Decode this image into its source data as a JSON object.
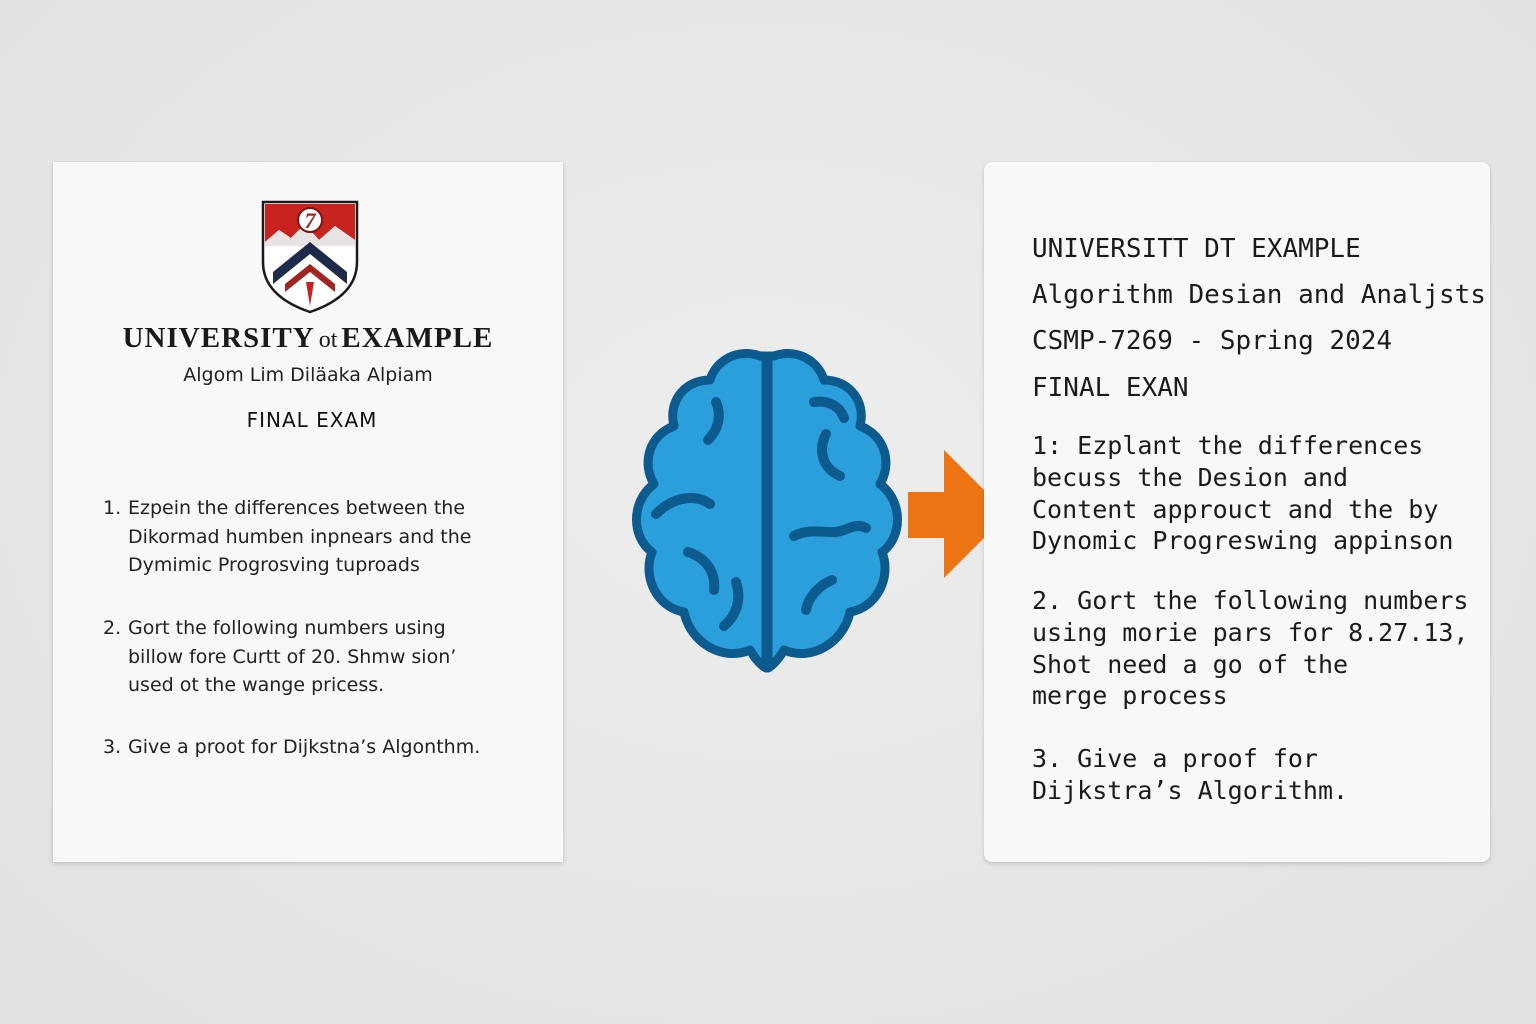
{
  "left_document": {
    "crest_text": "7",
    "university_parts": [
      "UNIVERSITY",
      "ot",
      "EXAMPLE"
    ],
    "subtitle": "Algom Lim Diläaka Alpiam",
    "exam_title": "FINAL EXAM",
    "questions": [
      {
        "number": "1.",
        "text": "Ezpein the differences between the\nDikormad humben inpnears and the\nDymimic Progrosving tuproads"
      },
      {
        "number": "2.",
        "text": "Gort the following numbers using\nbillow fore Curtt of 20. Shmw sion’\nused ot the wange pricess."
      },
      {
        "number": "3.",
        "text": "Give a proot for Dijkstna’s Algonthm."
      }
    ]
  },
  "right_document": {
    "header_lines": [
      "UNIVERSITT DT EXAMPLE",
      "Algorithm Desian and Analjsts",
      "CSMP-7269 - Spring 2024",
      "FINAL EXAN"
    ],
    "questions": [
      "1: Ezplant the differences\nbecuss the Desion and\nContent approuct and the by\nDynomic Progreswing appinson",
      "2. Gort the following numbers\nusing morie pars for 8.27.13,\nShot need a go of the\nmerge process",
      "3. Give a proof for\nDijkstra’s Algorithm."
    ]
  },
  "icons": {
    "crest": "university-crest-icon",
    "brain": "brain-icon",
    "arrow": "arrow-right-icon"
  },
  "colors": {
    "brain_fill": "#2b9fdb",
    "brain_outline": "#0d5a8f",
    "arrow": "#ec7413",
    "crest_red": "#c8231e",
    "crest_navy": "#1d2a4a"
  }
}
